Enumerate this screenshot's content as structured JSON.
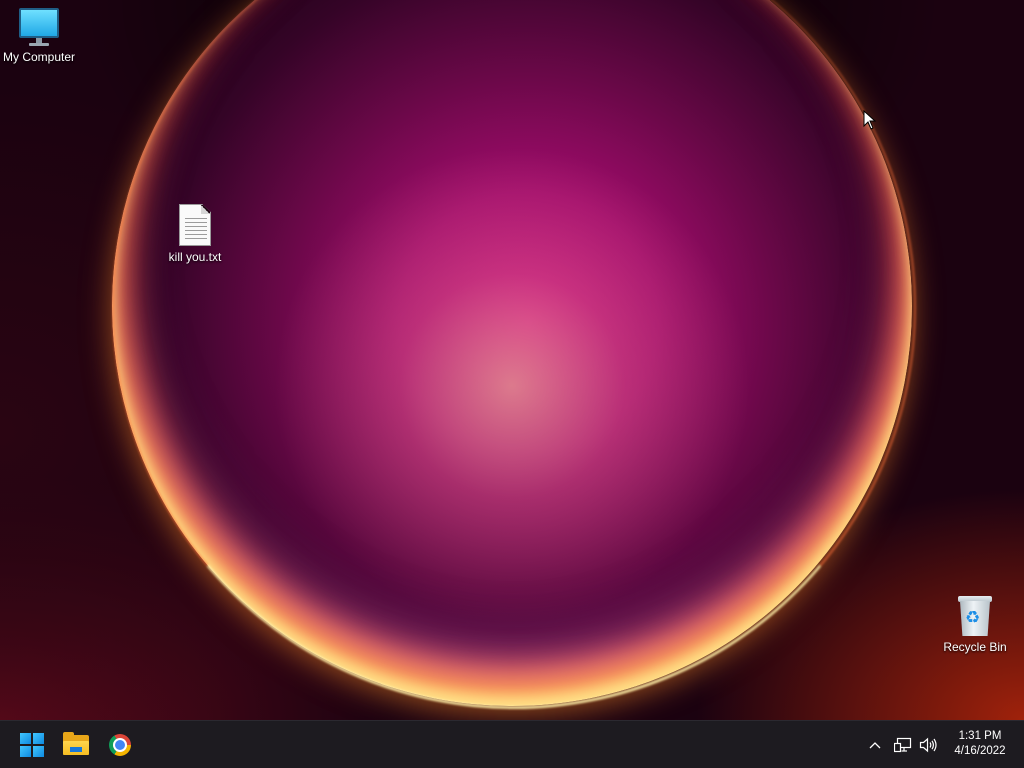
{
  "desktop": {
    "icons": [
      {
        "label": "My Computer",
        "icon": "computer-icon"
      },
      {
        "label": "kill you.txt",
        "icon": "text-file-icon"
      },
      {
        "label": "Recycle Bin",
        "icon": "recycle-bin-icon"
      }
    ]
  },
  "taskbar": {
    "pinned": [
      {
        "name": "Start",
        "icon": "windows-logo-icon"
      },
      {
        "name": "File Explorer",
        "icon": "folder-icon"
      },
      {
        "name": "Google Chrome",
        "icon": "chrome-icon"
      }
    ],
    "tray": {
      "icons": [
        "chevron-up-icon",
        "network-icon",
        "volume-icon"
      ],
      "time": "1:31 PM",
      "date": "4/16/2022"
    }
  },
  "colors": {
    "taskbar": "#1d1b20",
    "accent": "#1c8ee6"
  }
}
